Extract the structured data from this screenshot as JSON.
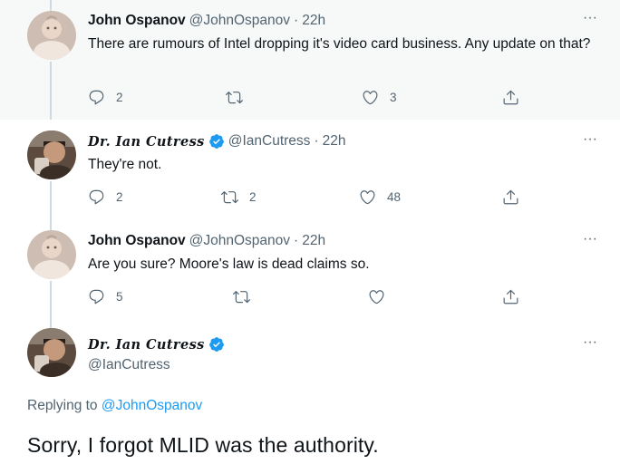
{
  "tweets": [
    {
      "name": "John Ospanov",
      "handle": "@JohnOspanov",
      "sep": "·",
      "time": "22h",
      "text": "There are rumours of Intel dropping it's video card business. Any update on that?",
      "replies": "2",
      "retweets": "",
      "likes": "3"
    },
    {
      "name": "Dr. Ian Cutress",
      "handle": "@IanCutress",
      "sep": "·",
      "time": "22h",
      "text": "They're not.",
      "replies": "2",
      "retweets": "2",
      "likes": "48"
    },
    {
      "name": "John Ospanov",
      "handle": "@JohnOspanov",
      "sep": "·",
      "time": "22h",
      "text": "Are you sure? Moore's law is dead claims so.",
      "replies": "5",
      "retweets": "",
      "likes": ""
    }
  ],
  "main_tweet": {
    "name": "Dr. Ian Cutress",
    "handle": "@IanCutress",
    "replying_prefix": "Replying to",
    "replying_to": "@JohnOspanov",
    "text": "Sorry, I forgot MLID was the authority."
  },
  "more_glyph": "···",
  "icons": {
    "reply": "reply-icon",
    "retweet": "retweet-icon",
    "like": "heart-icon",
    "share": "share-icon",
    "verified": "verified-badge-icon",
    "more": "more-options-icon"
  },
  "colors": {
    "text": "#0f1419",
    "secondary": "#536471",
    "accent": "#1d9bf0",
    "highlight_bg": "#f7f9f9",
    "thread_line": "#cfd9de"
  }
}
